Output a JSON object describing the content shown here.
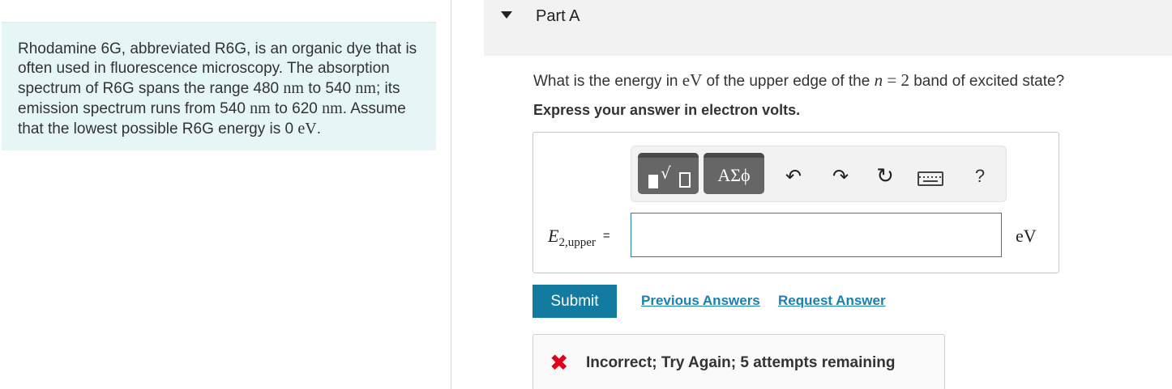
{
  "problem": {
    "seg1": "Rhodamine 6G, abbreviated R6G, is an organic dye that is often used in fluorescence microscopy. The absorption spectrum of R6G spans the range 480 ",
    "unit_nm_1": "nm",
    "seg2": " to 540 ",
    "unit_nm_2": "nm",
    "seg3": "; its emission spectrum runs from 540 ",
    "unit_nm_3": "nm",
    "seg4": " to 620 ",
    "unit_nm_4": "nm",
    "seg5": ". Assume that the lowest possible R6G energy is 0 ",
    "unit_ev": "eV",
    "seg6": "."
  },
  "part": {
    "title": "Part A"
  },
  "question": {
    "prefix": "What is the energy in ",
    "unit": "eV",
    "middle": " of the upper edge of the ",
    "var_n": "n",
    "eq": " = 2",
    "suffix": " band of excited state?"
  },
  "instruction": "Express your answer in electron volts.",
  "toolbar": {
    "greek_label": "ΑΣϕ",
    "help_label": "?",
    "templates_icon": "templates-icon",
    "undo_icon": "undo-icon",
    "redo_icon": "redo-icon",
    "reset_icon": "reset-icon",
    "keyboard_icon": "keyboard-icon"
  },
  "answer": {
    "variable": "E",
    "subscript": "2,upper",
    "equals": "=",
    "value": "",
    "unit": "eV"
  },
  "actions": {
    "submit_label": "Submit",
    "previous_answers_label": "Previous Answers",
    "request_answer_label": "Request Answer"
  },
  "feedback": {
    "message": "Incorrect; Try Again; 5 attempts remaining",
    "status_color": "#e0001b"
  },
  "colors": {
    "accent": "#137aa0",
    "link": "#1a7fb1",
    "intro_bg": "#e6f5f6",
    "header_bg": "#f2f2f2"
  }
}
